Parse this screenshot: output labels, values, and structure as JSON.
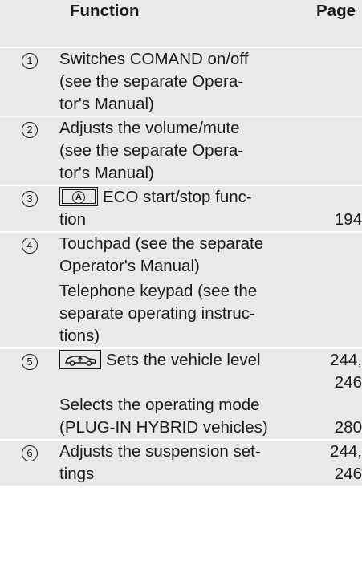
{
  "header": {
    "function_label": "Function",
    "page_label": "Page"
  },
  "rows": [
    {
      "number": "1",
      "lines": [
        "Switches COMAND on/off",
        "(see the separate Opera-",
        "tor's Manual)"
      ]
    },
    {
      "number": "2",
      "lines": [
        "Adjusts the volume/mute",
        "(see the separate Opera-",
        "tor's Manual)"
      ]
    },
    {
      "number": "3",
      "icon": "eco-start-stop-button-icon",
      "icon_letter": "A",
      "lines": [
        "ECO start/stop func-",
        "tion"
      ],
      "page": "194"
    },
    {
      "number": "4",
      "lines": [
        "Touchpad (see the separate",
        "Operator's Manual)"
      ],
      "lines2": [
        "Telephone keypad (see the",
        "separate operating instruc-",
        "tions)"
      ]
    },
    {
      "number": "5",
      "icon": "vehicle-level-button-icon",
      "lines": [
        "Sets the vehicle level"
      ],
      "page_lines": [
        "244,",
        "246"
      ],
      "lines2": [
        "Selects the operating mode",
        "(PLUG-IN HYBRID vehicles)"
      ],
      "page2": "280"
    },
    {
      "number": "6",
      "lines": [
        "Adjusts the suspension set-",
        "tings"
      ],
      "page_lines": [
        "244,",
        "246"
      ]
    }
  ]
}
